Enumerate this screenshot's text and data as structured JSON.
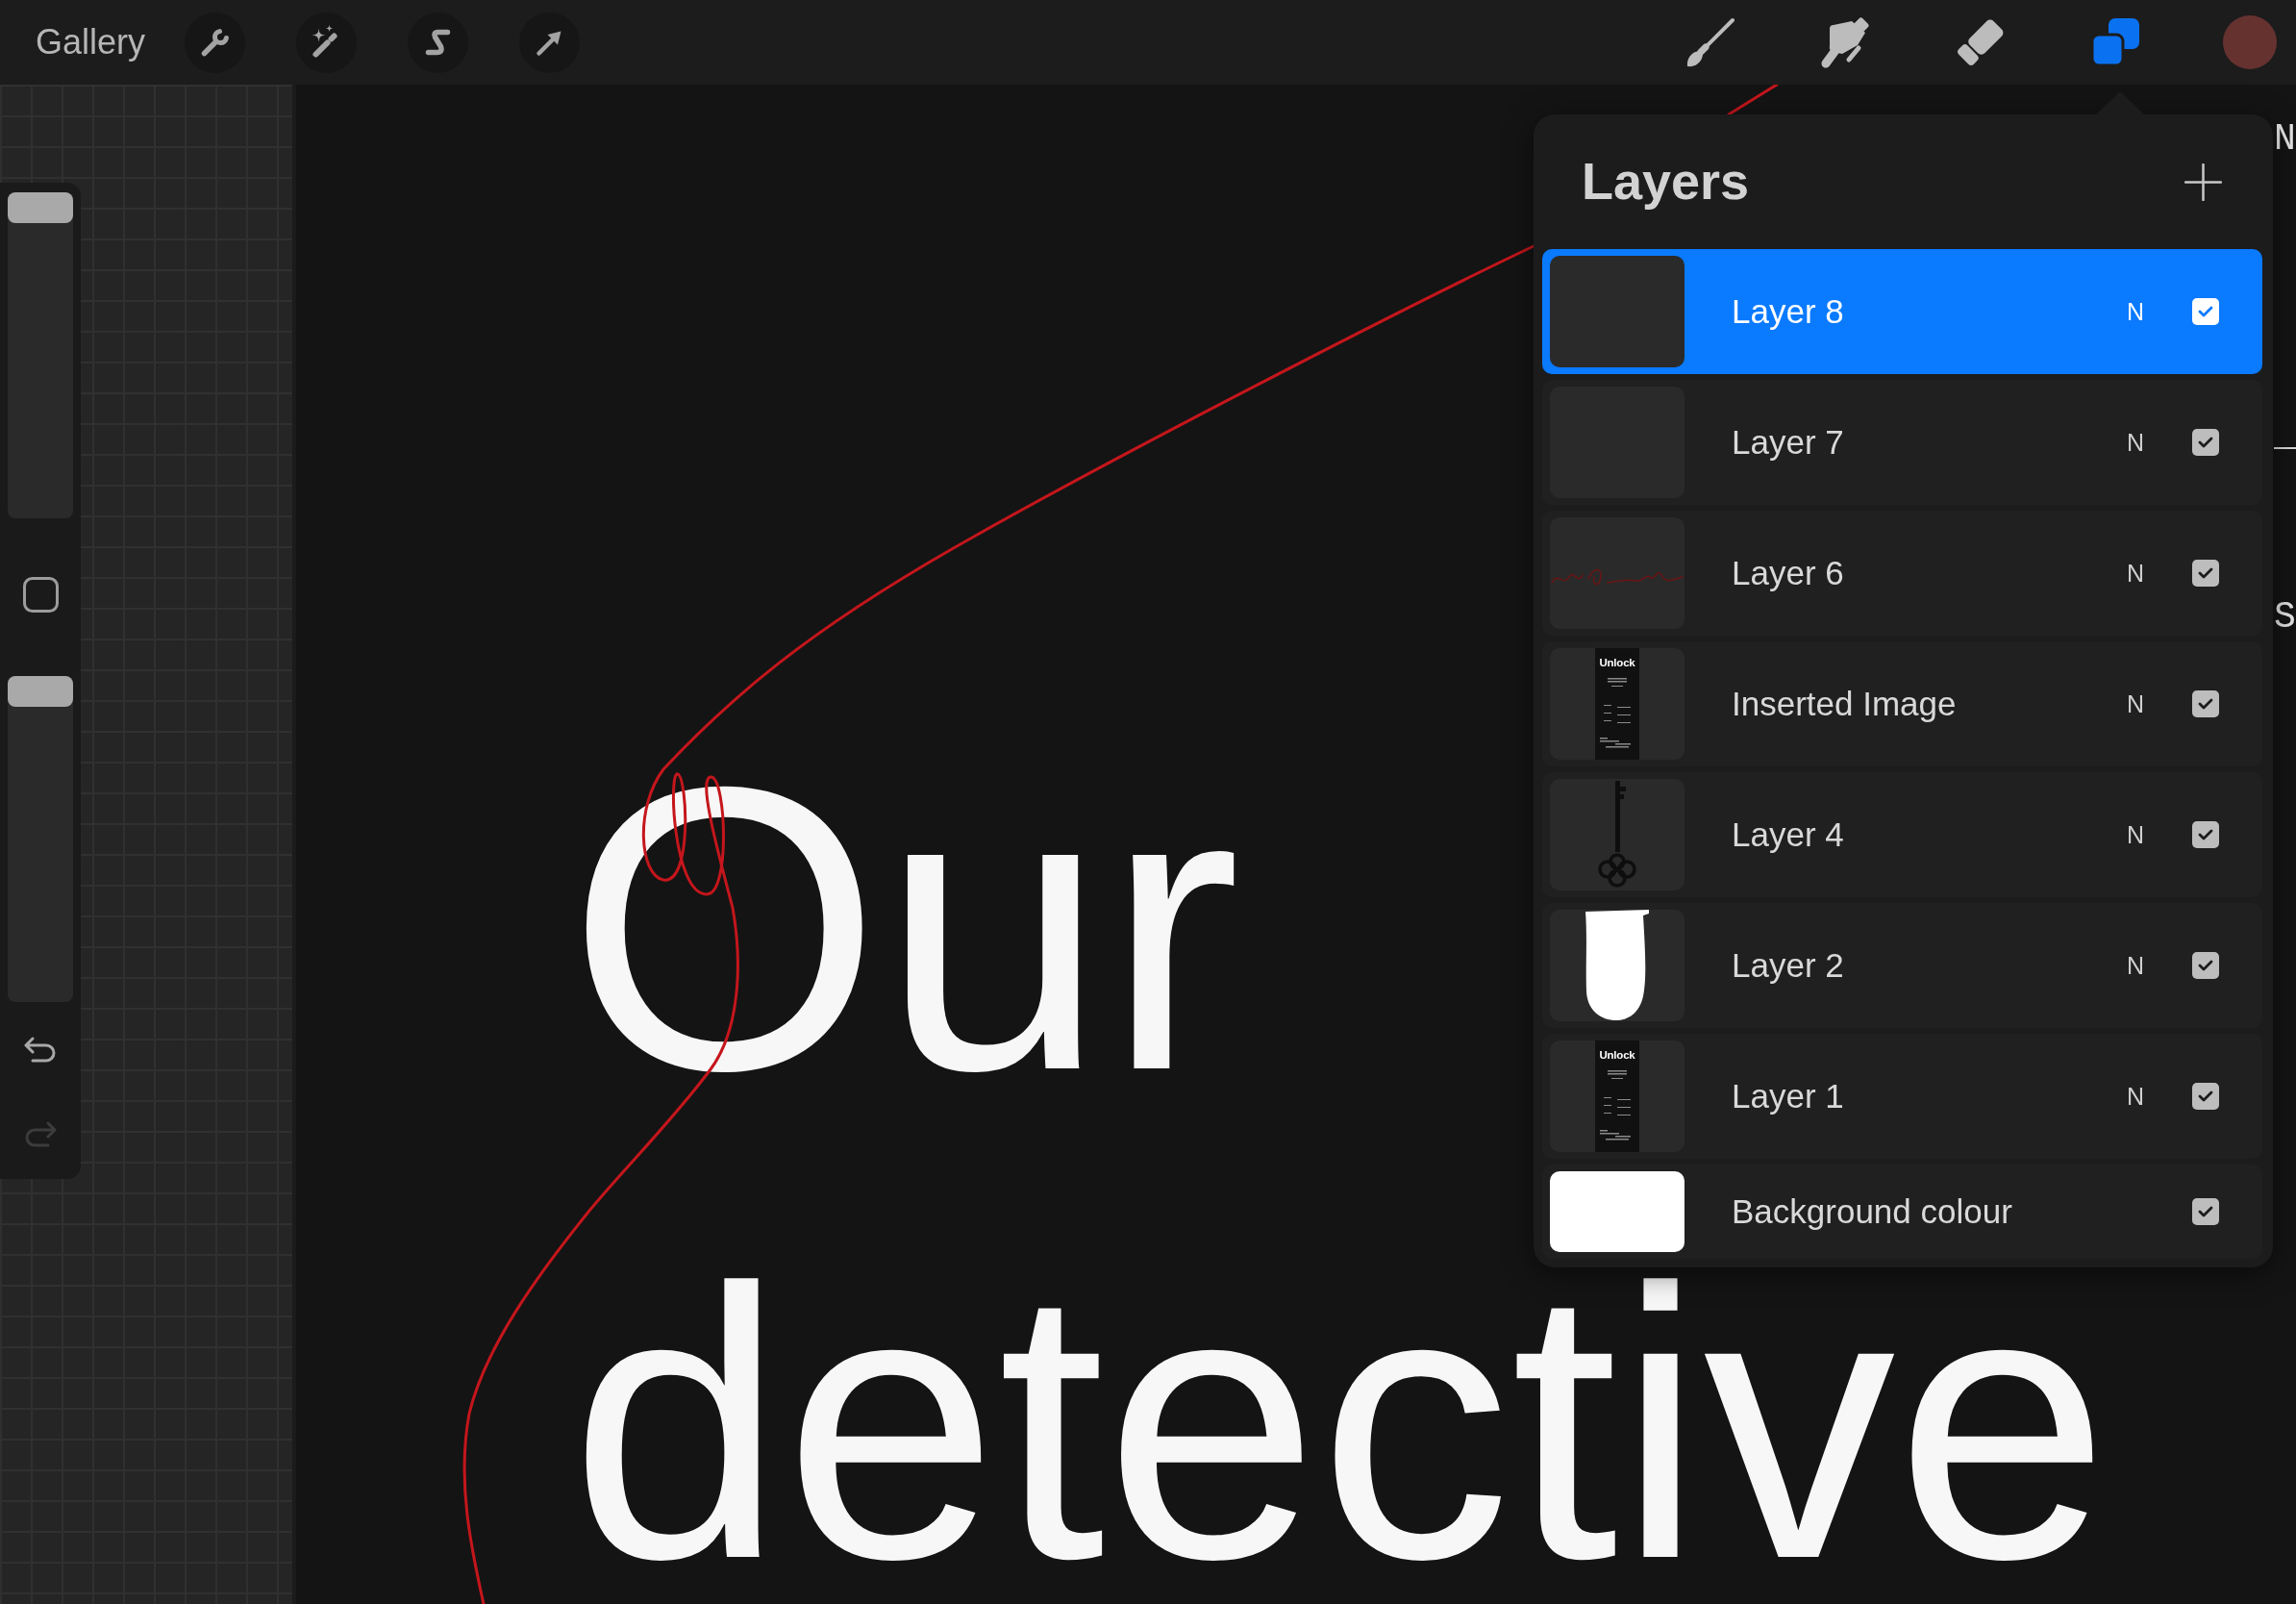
{
  "toolbar": {
    "gallery": "Gallery",
    "left_tools": [
      {
        "kind": "actions"
      },
      {
        "kind": "adjustments"
      },
      {
        "kind": "selection"
      },
      {
        "kind": "transform"
      }
    ],
    "right_tools": [
      {
        "kind": "brush",
        "selected": false
      },
      {
        "kind": "smudge",
        "selected": false
      },
      {
        "kind": "eraser",
        "selected": false
      },
      {
        "kind": "layers",
        "selected": true
      }
    ],
    "color": "#663230"
  },
  "sidebar": {
    "sliders": [
      {
        "level": 1
      },
      {
        "level": 1
      }
    ],
    "history": [
      {
        "kind": "undo",
        "disabled": false
      },
      {
        "kind": "redo",
        "disabled": true
      }
    ]
  },
  "canvas": {
    "lines": [
      "Our",
      "detective"
    ],
    "edge_letters": [
      "N",
      "S"
    ]
  },
  "layers_panel": {
    "title": "Layers",
    "layers": [
      {
        "kind": "layer",
        "name": "Layer 8",
        "blend": "N",
        "visible": true,
        "selected": true,
        "thumbnail": {
          "kind": "blank"
        }
      },
      {
        "kind": "layer",
        "name": "Layer 7",
        "blend": "N",
        "visible": true,
        "selected": false,
        "thumbnail": {
          "kind": "blank"
        }
      },
      {
        "kind": "layer",
        "name": "Layer 6",
        "blend": "N",
        "visible": true,
        "selected": false,
        "thumbnail": {
          "kind": "scribble"
        }
      },
      {
        "kind": "layer",
        "name": "Inserted Image",
        "blend": "N",
        "visible": true,
        "selected": false,
        "thumbnail": {
          "kind": "document",
          "text": "Unlock"
        }
      },
      {
        "kind": "layer",
        "name": "Layer 4",
        "blend": "N",
        "visible": true,
        "selected": false,
        "thumbnail": {
          "kind": "key"
        }
      },
      {
        "kind": "layer",
        "name": "Layer 2",
        "blend": "N",
        "visible": true,
        "selected": false,
        "thumbnail": {
          "kind": "shape"
        }
      },
      {
        "kind": "layer",
        "name": "Layer 1",
        "blend": "N",
        "visible": true,
        "selected": false,
        "thumbnail": {
          "kind": "document",
          "text": "Unlock"
        }
      },
      {
        "kind": "background",
        "name": "Background colour",
        "visible": true,
        "selected": false,
        "thumbnail": {
          "kind": "fill"
        }
      }
    ]
  }
}
